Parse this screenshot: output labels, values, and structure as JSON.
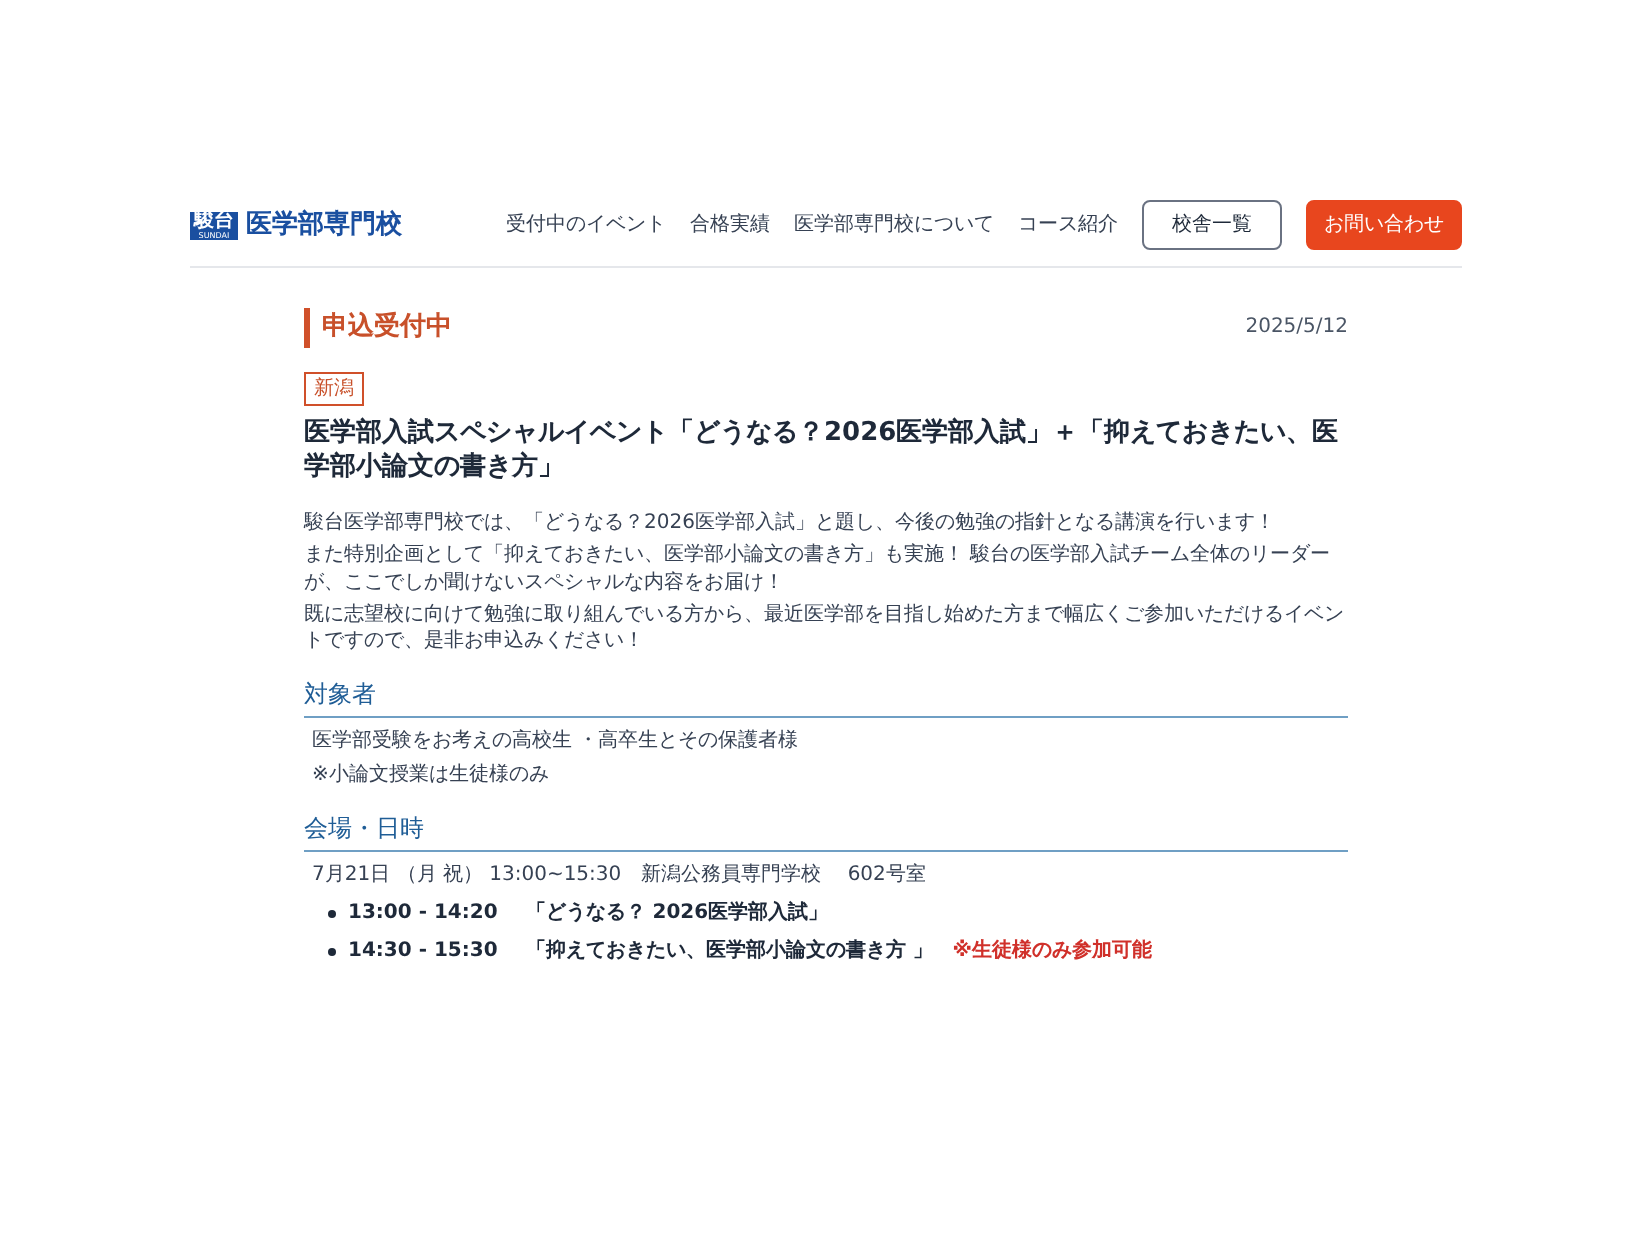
{
  "header": {
    "logo_mark": "駿台",
    "logo_sub": "SUNDAI",
    "site_name": "医学部専門校",
    "nav": [
      "受付中のイベント",
      "合格実績",
      "医学部専門校について",
      "コース紹介"
    ],
    "buttons": [
      {
        "label": "校舎一覧",
        "kind": "outline"
      },
      {
        "label": "お問い合わせ",
        "kind": "primary"
      }
    ]
  },
  "event": {
    "status": "申込受付中",
    "date": "2025/5/12",
    "tag": "新潟",
    "title": "医学部入試スペシャルイベント「どうなる？2026医学部入試」＋「抑えておきたい、医学部小論文の書き方」",
    "intro": [
      "駿台医学部専門校では、「どうなる？2026医学部入試」と題し、今後の勉強の指針となる講演を行います！",
      "また特別企画として「抑えておきたい、医学部小論文の書き方」も実施！ 駿台の医学部入試チーム全体のリーダーが、ここでしか聞けないスペシャルな内容をお届け！",
      "既に志望校に向けて勉強に取り組んでいる方から、最近医学部を目指し始めた方まで幅広くご参加いただけるイベントですので、是非お申込みください！"
    ],
    "sections": [
      {
        "heading": "対象者",
        "lines": [
          "医学部受験をお考えの高校生 ・高卒生とその保護者様",
          "※小論文授業は生徒様のみ"
        ]
      },
      {
        "heading": "会場・日時",
        "lines": [
          "7月21日 （月 祝） 13:00~15:30　新潟公務員専門学校　 602号室"
        ],
        "schedule": [
          {
            "time": "13:00 - 14:20",
            "title": "「どうなる？ 2026医学部入試」"
          },
          {
            "time": "14:30 - 15:30",
            "title": "「抑えておきたい、医学部小論文の書き方 」",
            "note": "※生徒様のみ参加可能"
          }
        ]
      }
    ]
  }
}
